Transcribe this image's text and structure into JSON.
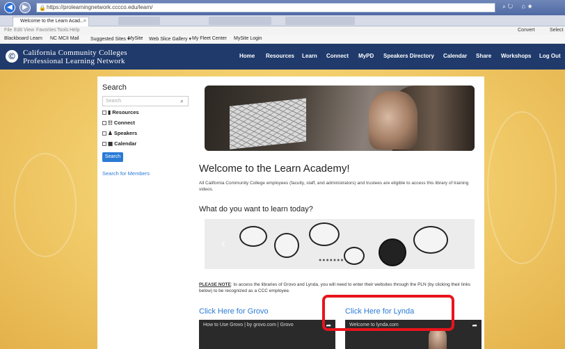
{
  "browser": {
    "url": "https://prolearningnetwork.cccco.edu/learn/",
    "tab_title": "Welcome to the Learn Acad...",
    "menu": [
      "File",
      "Edit",
      "View",
      "Favorites",
      "Tools",
      "Help"
    ],
    "menu_right": "Convert",
    "menu_right2": "Select",
    "favorites": [
      "Blackboard Learn",
      "NC MCII Mail",
      "Suggested Sites ▾",
      "MySite",
      "Web Slice Gallery ▾",
      "My Fleet Center",
      "MySite Login"
    ]
  },
  "site": {
    "logo_line1": "California Community Colleges",
    "logo_line2": "Professional Learning Network",
    "nav": [
      "Home",
      "Resources",
      "Learn",
      "Connect",
      "MyPD",
      "Speakers Directory",
      "Calendar",
      "Share",
      "Workshops",
      "Log Out"
    ]
  },
  "sidebar": {
    "title": "Search",
    "search_placeholder": "Search",
    "checks": [
      "Resources",
      "Connect",
      "Speakers",
      "Calendar"
    ],
    "button": "Search",
    "members_link": "Search for Members"
  },
  "main": {
    "welcome": "Welcome to the Learn Academy!",
    "intro": "All California Community College employees (faculty, staff, and administrators) and trustees are eligible to access this library of training videos.",
    "question": "What do you want to learn today?",
    "note_label": "PLEASE NOTE",
    "note_text": ": to access the libraries of Grovo and Lynda, you will need to enter their websites through the PLN (by clicking their links below) to be recognized as a CCC employee.",
    "grovo_link": "Click Here for Grovo",
    "lynda_link": "Click Here for Lynda",
    "grovo_video_title": "How to Use Grovo | by grovo.com | Grovo",
    "lynda_video_title": "Welcome to lynda.com"
  },
  "colors": {
    "header_bg": "#1f3a6b",
    "link": "#2a7ad6",
    "highlight": "#e8141c"
  }
}
